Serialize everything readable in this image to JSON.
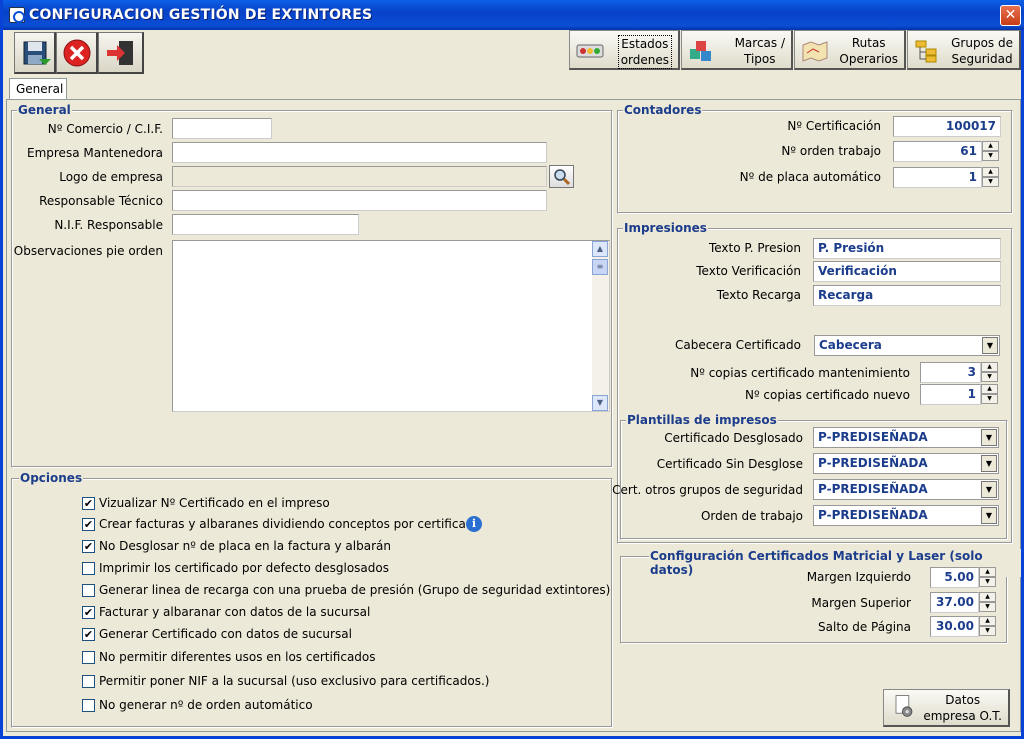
{
  "window": {
    "title": "CONFIGURACION GESTIÓN DE EXTINTORES",
    "close_label": "✕"
  },
  "toolbar": {
    "save_icon": "save-icon",
    "cancel_icon": "cancel-icon",
    "exit_icon": "exit-icon"
  },
  "topbuttons": {
    "estados": "Estados\nordenes",
    "marcas": "Marcas /\nTipos",
    "rutas": "Rutas\nOperarios",
    "grupos": "Grupos de\nSeguridad"
  },
  "tabs": {
    "general": "General"
  },
  "general": {
    "group_label": "General",
    "comercio_label": "Nº Comercio / C.I.F.",
    "comercio_value": "",
    "empresa_label": "Empresa Mantenedora",
    "empresa_value": "",
    "logo_label": "Logo de empresa",
    "logo_value": "",
    "responsable_label": "Responsable Técnico",
    "responsable_value": "",
    "nif_label": "N.I.F. Responsable",
    "nif_value": "",
    "obs_label": "Observaciones pie orden",
    "obs_value": ""
  },
  "opciones": {
    "group_label": "Opciones",
    "items": [
      {
        "label": "Vizualizar Nº Certificado en el impreso",
        "checked": "✔"
      },
      {
        "label": "Crear facturas y albaranes dividiendo conceptos por certificado",
        "checked": "✔"
      },
      {
        "label": "No Desglosar nº de placa en la factura y albarán",
        "checked": "✔"
      },
      {
        "label": "Imprimir los certificado por defecto desglosados",
        "checked": ""
      },
      {
        "label": "Generar linea de recarga con una prueba de presión (Grupo de seguridad extintores)",
        "checked": ""
      },
      {
        "label": "Facturar y albaranar con datos de la sucursal",
        "checked": "✔"
      },
      {
        "label": "Generar Certificado con datos de sucursal",
        "checked": "✔"
      },
      {
        "label": "No permitir diferentes usos en los certificados",
        "checked": ""
      },
      {
        "label": "Permitir poner NIF a la sucursal (uso exclusivo para certificados.)",
        "checked": ""
      },
      {
        "label": "No generar nº de orden automático",
        "checked": ""
      }
    ]
  },
  "contadores": {
    "group_label": "Contadores",
    "cert_label": "Nº Certificación",
    "cert_value": "100017",
    "orden_label": "Nº orden trabajo",
    "orden_value": "61",
    "placa_label": "Nº de placa automático",
    "placa_value": "1"
  },
  "impresiones": {
    "group_label": "Impresiones",
    "presion_label": "Texto P. Presion",
    "presion_value": "P. Presión",
    "verif_label": "Texto Verificación",
    "verif_value": "Verificación",
    "recarga_label": "Texto Recarga",
    "recarga_value": "Recarga",
    "cabecera_label": "Cabecera Certificado",
    "cabecera_value": "Cabecera",
    "copias_mant_label": "Nº copias certificado mantenimiento",
    "copias_mant_value": "3",
    "copias_nuevo_label": "Nº copias certificado nuevo",
    "copias_nuevo_value": "1"
  },
  "plantillas": {
    "group_label": "Plantillas de impresos",
    "desglosado_label": "Certificado Desglosado",
    "desglosado_value": "P-PREDISEÑADA",
    "sin_label": "Certificado Sin Desglose",
    "sin_value": "P-PREDISEÑADA",
    "otros_label": "Cert. otros grupos de seguridad",
    "otros_value": "P-PREDISEÑADA",
    "orden_label": "Orden de trabajo",
    "orden_value": "P-PREDISEÑADA"
  },
  "matricial": {
    "group_label": "Configuración Certificados Matricial y Laser (solo datos)",
    "izq_label": "Margen Izquierdo",
    "izq_value": "5.00",
    "sup_label": "Margen Superior",
    "sup_value": "37.00",
    "salto_label": "Salto de Página",
    "salto_value": "30.00"
  },
  "datos_button": "Datos\nempresa O.T."
}
